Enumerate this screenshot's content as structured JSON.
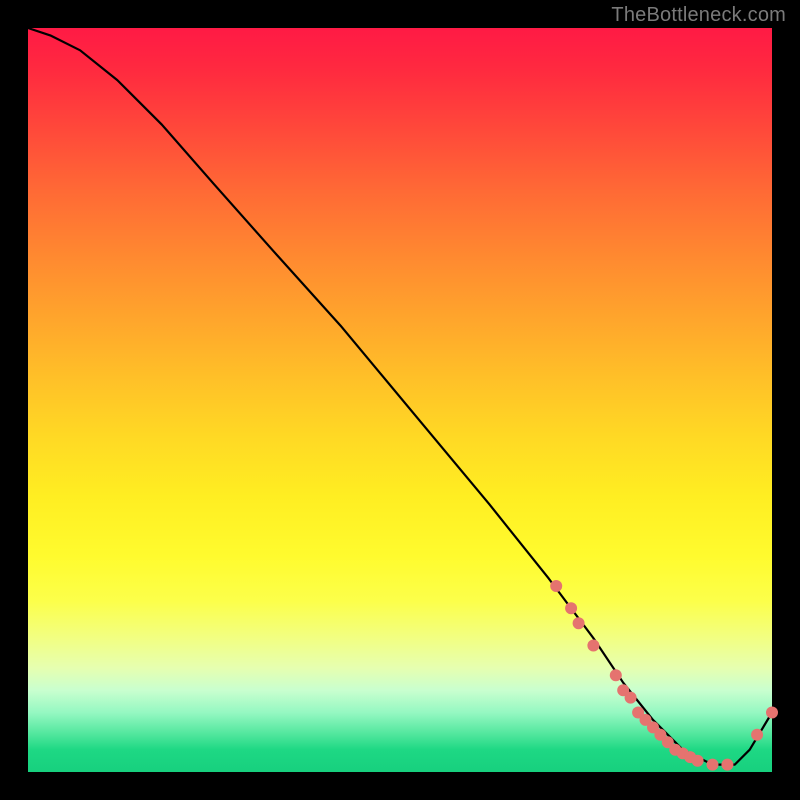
{
  "watermark": "TheBottleneck.com",
  "chart_data": {
    "type": "line",
    "title": "",
    "xlabel": "",
    "ylabel": "",
    "xlim": [
      0,
      100
    ],
    "ylim": [
      0,
      100
    ],
    "grid": false,
    "legend": false,
    "series": [
      {
        "name": "curve",
        "color": "#000000",
        "x": [
          0,
          3,
          7,
          12,
          18,
          25,
          33,
          42,
          52,
          62,
          70,
          76,
          80,
          84,
          88,
          92,
          95,
          97,
          100
        ],
        "y": [
          100,
          99,
          97,
          93,
          87,
          79,
          70,
          60,
          48,
          36,
          26,
          18,
          12,
          7,
          3,
          1,
          1,
          3,
          8
        ]
      },
      {
        "name": "markers",
        "color": "#e5736f",
        "type": "scatter",
        "x": [
          71,
          73,
          74,
          76,
          79,
          80,
          81,
          82,
          83,
          84,
          85,
          86,
          87,
          88,
          89,
          90,
          92,
          94,
          98,
          100
        ],
        "y": [
          25,
          22,
          20,
          17,
          13,
          11,
          10,
          8,
          7,
          6,
          5,
          4,
          3,
          2.5,
          2,
          1.5,
          1,
          1,
          5,
          8
        ]
      }
    ]
  },
  "colors": {
    "curve": "#000000",
    "marker_fill": "#e5736f",
    "background_black": "#000000"
  }
}
